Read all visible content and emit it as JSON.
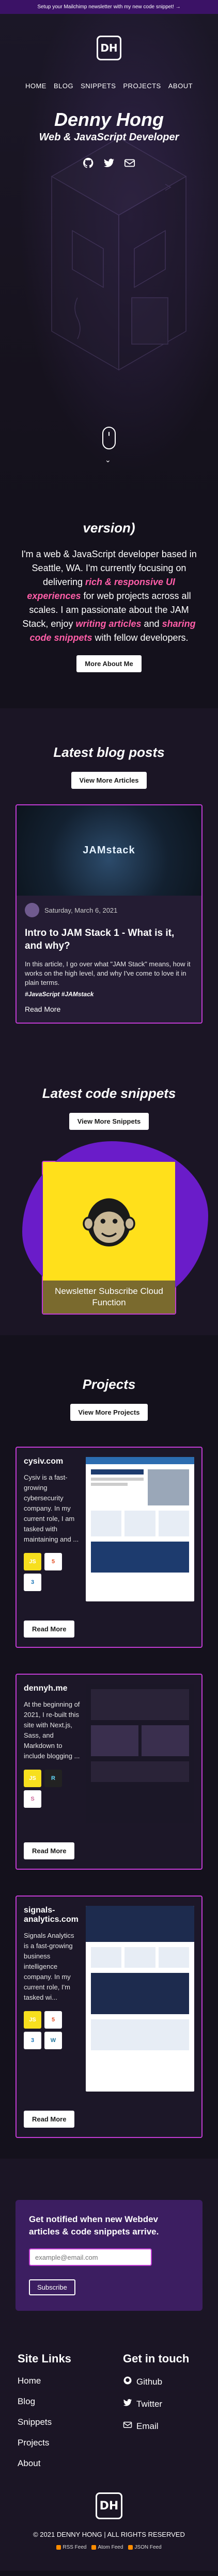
{
  "announcement": "Setup your Mailchimp newsletter with my new code snippet! →",
  "logo_text": "DH",
  "nav": [
    {
      "label": "HOME"
    },
    {
      "label": "BLOG"
    },
    {
      "label": "SNIPPETS"
    },
    {
      "label": "PROJECTS"
    },
    {
      "label": "ABOUT"
    }
  ],
  "hero": {
    "name": "Denny Hong",
    "tagline": "Web & JavaScript Developer",
    "social_icons": [
      "github-icon",
      "twitter-icon",
      "email-icon"
    ]
  },
  "about": {
    "title": "Who am I? (the TL;DR version)",
    "intro_before": "I'm a web & JavaScript developer based in Seattle, WA. I'm currently focusing on delivering ",
    "intro_highlight1": "rich & responsive UI experiences",
    "intro_middle": " for web projects across all scales. I am passionate about the JAM Stack, enjoy ",
    "intro_highlight2": "writing articles",
    "intro_and": " and ",
    "intro_highlight3": "sharing code snippets",
    "intro_after": " with fellow developers.",
    "button": "More About Me"
  },
  "blog": {
    "title": "Latest blog posts",
    "button": "View More Articles",
    "post": {
      "image_text": "JAMstack",
      "date": "Saturday, March 6, 2021",
      "title": "Intro to JAM Stack 1 - What is it, and why?",
      "excerpt": "In this article, I go over what \"JAM Stack\" means, how it works on the high level, and why I've come to love it in plain terms.",
      "tags": "#JavaScript #JAMstack",
      "read_more": "Read More"
    }
  },
  "snippets": {
    "title": "Latest code snippets",
    "button": "View More Snippets",
    "card_label": "Newsletter Subscribe Cloud Function"
  },
  "projects": {
    "title": "Projects",
    "button": "View More Projects",
    "items": [
      {
        "name": "cysiv.com",
        "desc": "Cysiv is a fast-growing cybersecurity company. In my current role, I am tasked with maintaining and ...",
        "tech": [
          "JS",
          "5",
          "3"
        ],
        "button": "Read More"
      },
      {
        "name": "dennyh.me",
        "desc": "At the beginning of 2021, I re-built this site with Next.js, Sass, and Markdown to include blogging ...",
        "tech": [
          "JS",
          "R",
          "S"
        ],
        "button": "Read More"
      },
      {
        "name": "signals-analytics.com",
        "desc": "Signals Analytics is a fast-growing business intelligence company. In my current role, I'm tasked wi...",
        "tech": [
          "JS",
          "5",
          "3",
          "W"
        ],
        "button": "Read More"
      }
    ]
  },
  "newsletter": {
    "title": "Get notified when new Webdev articles & code snippets arrive.",
    "placeholder": "example@email.com",
    "button": "Subscribe"
  },
  "footer": {
    "links_title": "Site Links",
    "links": [
      "Home",
      "Blog",
      "Snippets",
      "Projects",
      "About"
    ],
    "contact_title": "Get in touch",
    "contacts": [
      {
        "label": "Github",
        "icon": "github-icon"
      },
      {
        "label": "Twitter",
        "icon": "twitter-icon"
      },
      {
        "label": "Email",
        "icon": "email-icon"
      }
    ],
    "copyright": "© 2021 DENNY HONG | ALL RIGHTS RESERVED",
    "feeds": [
      "RSS Feed",
      "Atom Feed",
      "JSON Feed"
    ]
  },
  "colors": {
    "accent": "#c23bd4",
    "highlight": "#ff5ea8",
    "background": "#14111c",
    "purple": "#6a1cc9"
  }
}
